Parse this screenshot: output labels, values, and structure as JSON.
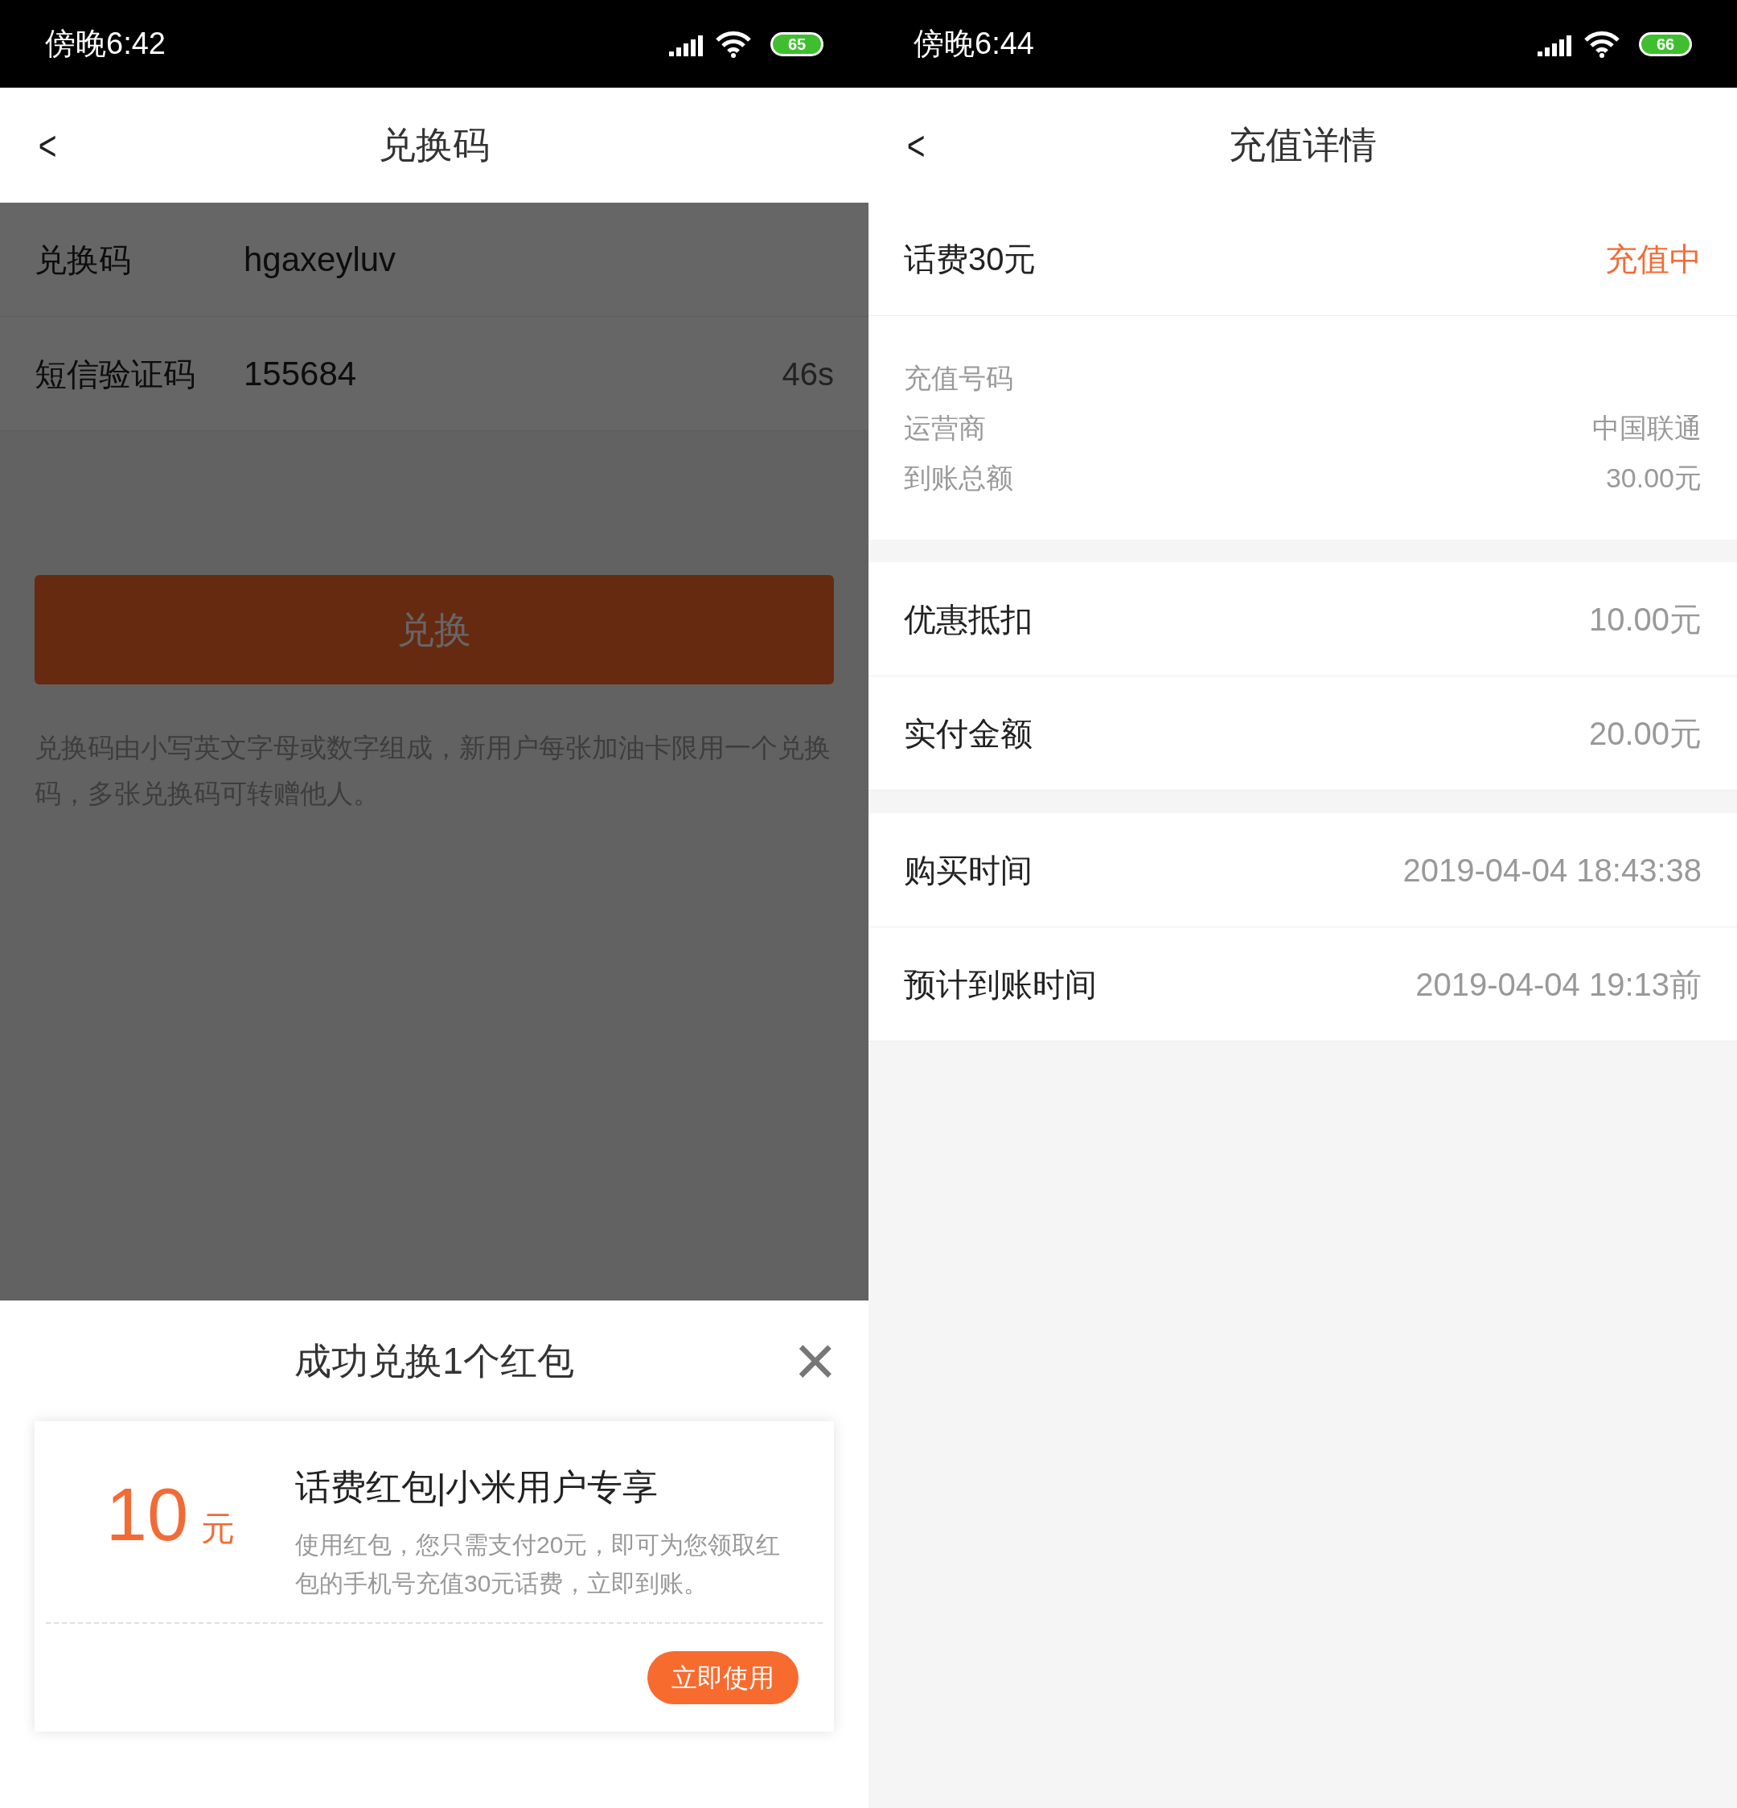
{
  "redeem_screen": {
    "status_bar": {
      "time": "傍晚6:42",
      "battery": "65"
    },
    "header": {
      "back": "<",
      "title": "兑换码"
    },
    "fields": [
      {
        "label": "兑换码",
        "value": "hgaxeyluv"
      },
      {
        "label": "短信验证码",
        "value": "155684",
        "countdown": "46s"
      }
    ],
    "submit_button": "兑换",
    "hint": "兑换码由小写英文字母或数字组成，新用户每张加油卡限用一个兑换码，多张兑换码可转赠他人。",
    "sheet": {
      "title": "成功兑换1个红包",
      "close": "×",
      "coupon": {
        "amount": "10",
        "unit": "元",
        "name": "话费红包|小米用户专享",
        "description": "使用红包，您只需支付20元，即可为您领取红包的手机号充值30元话费，立即到账。",
        "use_button": "立即使用"
      }
    }
  },
  "detail_screen": {
    "status_bar": {
      "time": "傍晚6:44",
      "battery": "66"
    },
    "header": {
      "back": "<",
      "title": "充值详情"
    },
    "summary": {
      "label": "话费30元",
      "status": "充值中"
    },
    "details": [
      {
        "label": "充值号码"
      },
      {
        "label": "运营商",
        "value": "中国联通"
      },
      {
        "label": "到账总额",
        "value": "30.00元"
      }
    ],
    "groups": [
      [
        {
          "label": "优惠抵扣",
          "value": "10.00元"
        },
        {
          "label": "实付金额",
          "value": "20.00元"
        }
      ],
      [
        {
          "label": "购买时间",
          "value": "2019-04-04 18:43:38"
        },
        {
          "label": "预计到账时间",
          "value": "2019-04-04 19:13前"
        }
      ]
    ]
  }
}
